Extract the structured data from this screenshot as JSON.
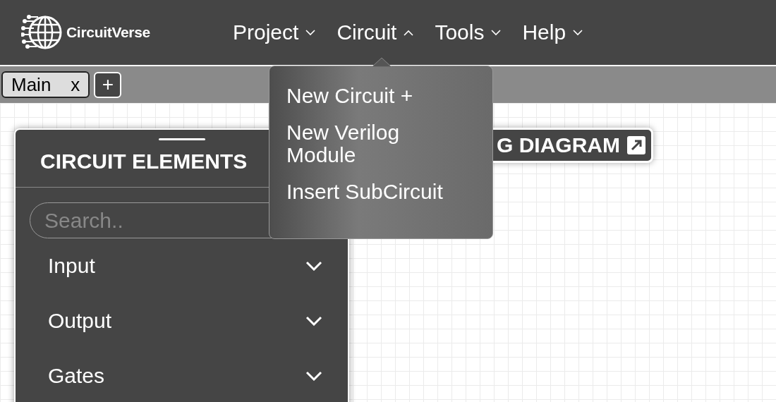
{
  "brand": {
    "name": "CircuitVerse"
  },
  "menu": [
    {
      "label": "Project",
      "expanded": false
    },
    {
      "label": "Circuit",
      "expanded": true
    },
    {
      "label": "Tools",
      "expanded": false
    },
    {
      "label": "Help",
      "expanded": false
    }
  ],
  "tabs": [
    {
      "label": "Main",
      "close": "x"
    }
  ],
  "add_tab": "+",
  "dropdown": {
    "items": [
      "New Circuit +",
      "New Verilog Module",
      "Insert SubCircuit"
    ]
  },
  "timing_button": {
    "label": "G DIAGRAM"
  },
  "panel": {
    "title": "CIRCUIT ELEMENTS",
    "search": {
      "placeholder": "Search.."
    },
    "groups": [
      {
        "label": "Input",
        "expanded": false
      },
      {
        "label": "Output",
        "expanded": false
      },
      {
        "label": "Gates",
        "expanded": false
      }
    ]
  }
}
